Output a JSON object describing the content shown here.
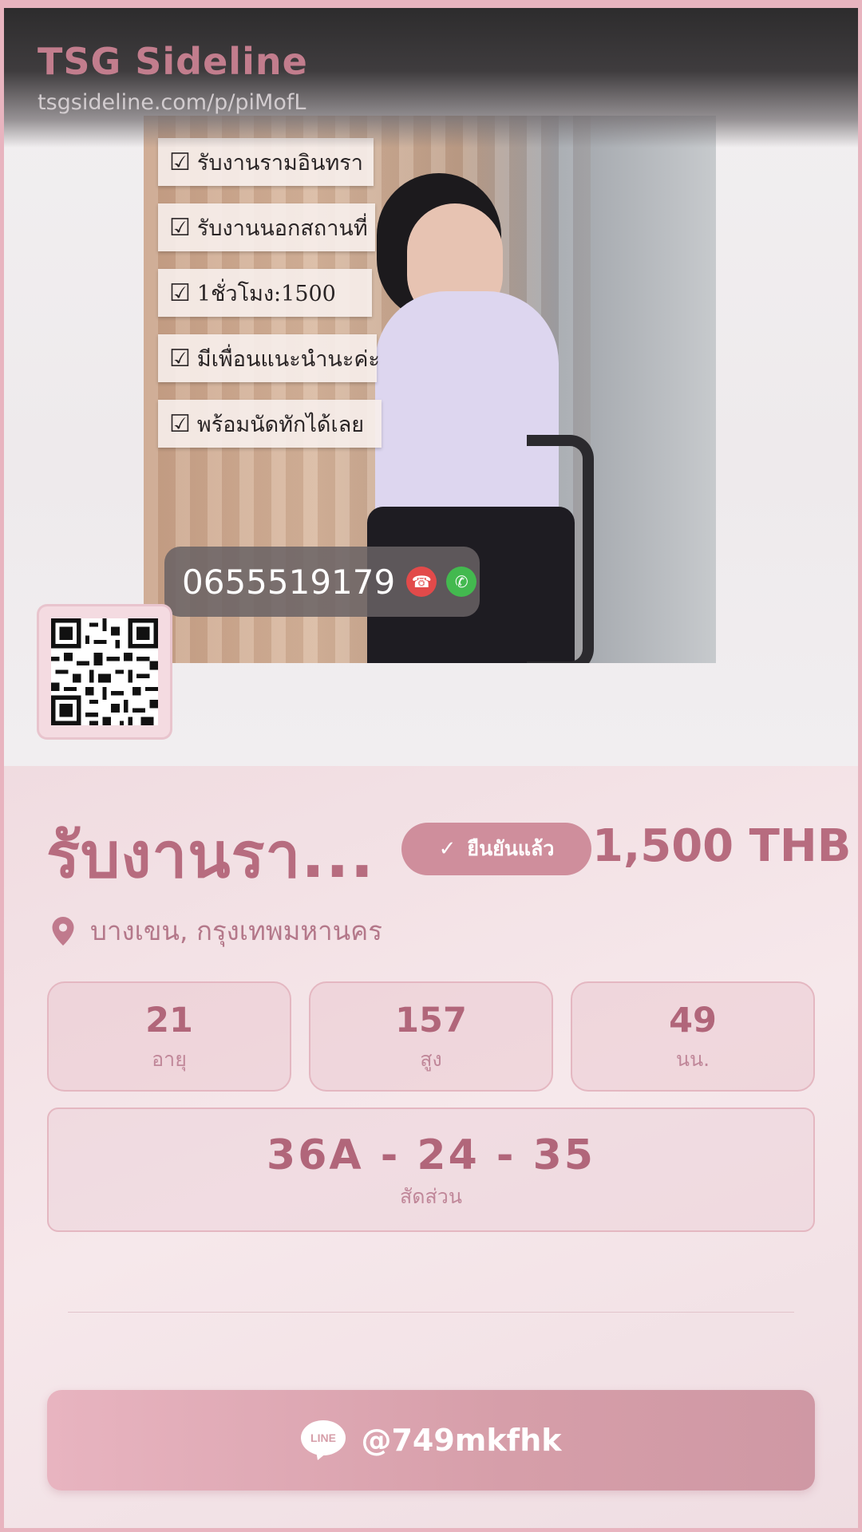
{
  "header": {
    "site_name": "TSG Sideline",
    "url": "tsgsideline.com/p/piMofL"
  },
  "photo": {
    "checklist": [
      "รับงานรามอินทรา",
      "รับงานนอกสถานที่",
      "1ชั่วโมง:1500",
      "มีเพื่อนแนะนำนะค่ะ",
      "พร้อมนัดทักได้เลย"
    ],
    "phone": "0655519179"
  },
  "profile": {
    "title": "รับงานรา...",
    "verified_label": "ยืนยันแล้ว",
    "price": "1,500 THB",
    "location": "บางเขน, กรุงเทพมหานคร",
    "stats": [
      {
        "value": "21",
        "label": "อายุ"
      },
      {
        "value": "157",
        "label": "สูง"
      },
      {
        "value": "49",
        "label": "นน."
      }
    ],
    "measurements": {
      "value": "36A - 24 - 35",
      "label": "สัดส่วน"
    }
  },
  "contact": {
    "line_logo_text": "LINE",
    "line_id": "@749mkfhk"
  },
  "colors": {
    "accent": "#b76c7f",
    "badge": "#cf8e9c",
    "button": "#d69ea9"
  }
}
